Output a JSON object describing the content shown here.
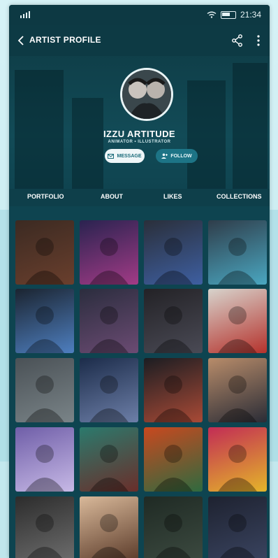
{
  "status_bar": {
    "time": "21:34"
  },
  "app_bar": {
    "title": "ARTIST PROFILE"
  },
  "profile": {
    "name": "IZZU ARTITUDE",
    "role": "ANIMATOR • ILLUSTRATOR"
  },
  "actions": {
    "message_label": "MESSAGE",
    "follow_label": "FOLLOW"
  },
  "tabs": [
    "PORTFOLIO",
    "ABOUT",
    "LIKES",
    "COLLECTIONS"
  ],
  "gallery": [
    {
      "name": "artwork-dark-figure",
      "colors": [
        "#3b2a22",
        "#6a3f2d"
      ]
    },
    {
      "name": "artwork-neon-night",
      "colors": [
        "#2a2350",
        "#a23b86"
      ]
    },
    {
      "name": "artwork-man-jacket",
      "colors": [
        "#2a2f3a",
        "#3e5fa1"
      ]
    },
    {
      "name": "artwork-drip-portrait",
      "colors": [
        "#2f3d4a",
        "#4aa7c1"
      ]
    },
    {
      "name": "artwork-circle-portrait",
      "colors": [
        "#1b2430",
        "#4e7fc0"
      ]
    },
    {
      "name": "artwork-venom-portrait",
      "colors": [
        "#2b2d3e",
        "#6b4b73"
      ]
    },
    {
      "name": "artwork-horned-face",
      "colors": [
        "#232226",
        "#4a4a55"
      ]
    },
    {
      "name": "artwork-red-figure",
      "colors": [
        "#d7d3cc",
        "#b5322c"
      ]
    },
    {
      "name": "artwork-ghost-figures",
      "colors": [
        "#4a5156",
        "#7a8488"
      ]
    },
    {
      "name": "artwork-angel-couple",
      "colors": [
        "#1c2c4a",
        "#6d7fa8"
      ]
    },
    {
      "name": "artwork-rain-couple",
      "colors": [
        "#1b1d22",
        "#a94a36"
      ]
    },
    {
      "name": "artwork-hand-face",
      "colors": [
        "#b88c6a",
        "#2a2c36"
      ]
    },
    {
      "name": "artwork-smoke-portrait",
      "colors": [
        "#6f5ea8",
        "#c7b9e6"
      ]
    },
    {
      "name": "artwork-teal-face",
      "colors": [
        "#2b7a6d",
        "#6a2e2a"
      ]
    },
    {
      "name": "artwork-colorful-crowd",
      "colors": [
        "#c9481f",
        "#2f6a3f"
      ]
    },
    {
      "name": "artwork-pop-portrait",
      "colors": [
        "#c22c55",
        "#e4b52a"
      ]
    },
    {
      "name": "artwork-bw-portrait",
      "colors": [
        "#2c2c2c",
        "#6d6d6d"
      ]
    },
    {
      "name": "artwork-eye-closeup",
      "colors": [
        "#d9b99a",
        "#5b3b2a"
      ]
    },
    {
      "name": "artwork-hooded-figure",
      "colors": [
        "#1f2a24",
        "#3c4a40"
      ]
    },
    {
      "name": "artwork-dark-interior",
      "colors": [
        "#1e2230",
        "#3a4460"
      ]
    }
  ]
}
